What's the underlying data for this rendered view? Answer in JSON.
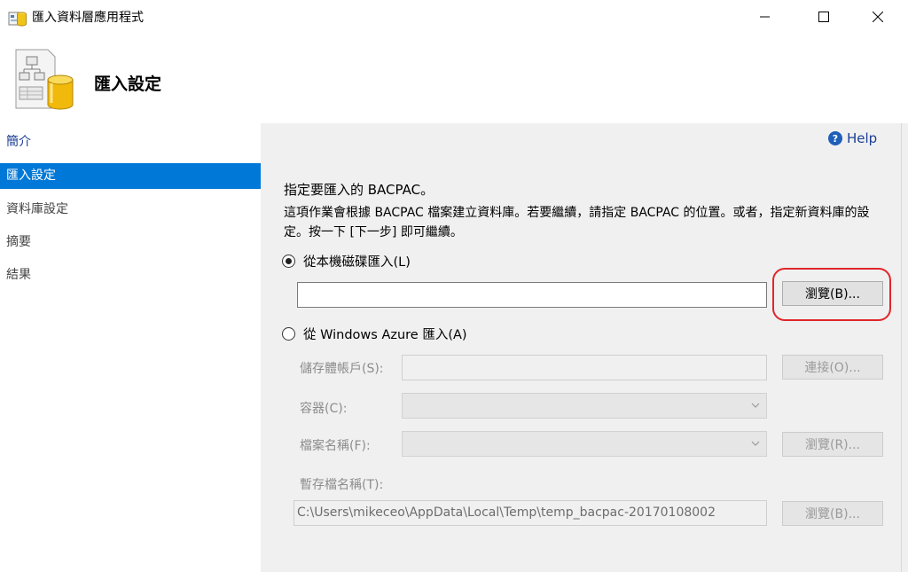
{
  "window": {
    "title": "匯入資料層應用程式"
  },
  "header": {
    "title": "匯入設定"
  },
  "nav": {
    "items": [
      {
        "label": "簡介"
      },
      {
        "label": "匯入設定"
      },
      {
        "label": "資料庫設定"
      },
      {
        "label": "摘要"
      },
      {
        "label": "結果"
      }
    ],
    "active_index": 1
  },
  "main": {
    "help_label": "Help",
    "section_title": "指定要匯入的 BACPAC。",
    "description": "這項作業會根據 BACPAC 檔案建立資料庫。若要繼續，請指定 BACPAC 的位置。或者，指定新資料庫的設定。按一下 [下一步] 即可繼續。",
    "local_option": {
      "label": "從本機磁碟匯入(L)",
      "selected": true,
      "path_value": "",
      "browse_label": "瀏覽(B)..."
    },
    "azure_option": {
      "label": "從 Windows Azure 匯入(A)",
      "selected": false,
      "storage_account_label": "儲存體帳戶(S):",
      "storage_account_value": "",
      "connect_label": "連接(O)...",
      "container_label": "容器(C):",
      "container_value": "",
      "file_name_label": "檔案名稱(F):",
      "file_name_value": "",
      "file_browse_label": "瀏覽(R)...",
      "temp_file_label": "暫存檔名稱(T):",
      "temp_file_value": "C:\\Users\\mikeceo\\AppData\\Local\\Temp\\temp_bacpac-20170108002",
      "temp_browse_label": "瀏覽(B)..."
    }
  },
  "colors": {
    "accent": "#0078d7",
    "highlight": "#e0262a",
    "panel": "#f0f0f0",
    "link": "#1c3f94"
  }
}
